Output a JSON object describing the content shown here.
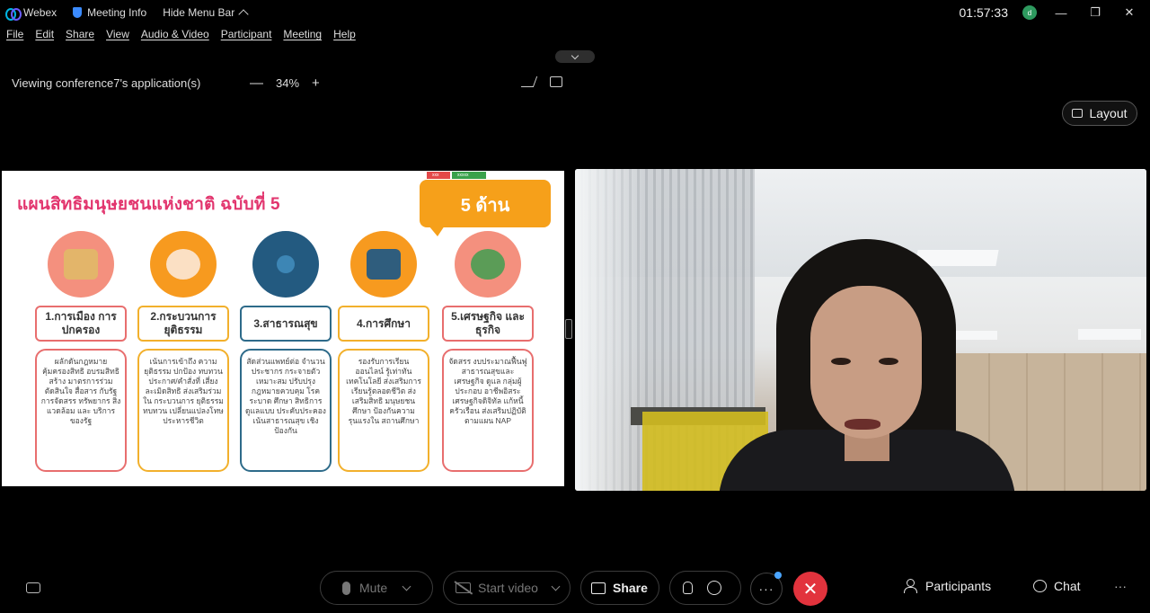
{
  "titlebar": {
    "app_name": "Webex",
    "meeting_info": "Meeting Info",
    "hide_menu": "Hide Menu Bar",
    "clock": "01:57:33",
    "avatar_initials": "d",
    "minimize": "—",
    "restore": "❐",
    "close": "✕"
  },
  "menu": {
    "items": [
      "File",
      "Edit",
      "Share",
      "View",
      "Audio & Video",
      "Participant",
      "Meeting",
      "Help"
    ]
  },
  "sharebar": {
    "viewing_text": "Viewing conference7's application(s)",
    "zoom_out": "—",
    "zoom_level": "34%",
    "zoom_in": "+"
  },
  "layout_button": "Layout",
  "slide": {
    "title": "แผนสิทธิมนุษยชนแห่งชาติ ฉบับที่ 5",
    "badge": "5 ด้าน",
    "mini_badges": [
      "xxx",
      "xxxxx"
    ],
    "columns": [
      {
        "label": "1.การเมือง การปกครอง",
        "desc": "ผลักดันกฎหมาย คุ้มครองสิทธิ อบรมสิทธิ สร้าง มาตรการร่วม ตัดสินใจ สื่อสาร กับรัฐ การจัดสรร ทรัพยากร สิ่งแวดล้อม และ บริการของรัฐ",
        "color": "#e86e6e",
        "circle": "#f4907e",
        "icon": "temple-icon"
      },
      {
        "label": "2.กระบวนการ ยุติธรรม",
        "desc": "เน้นการเข้าถึง ความยุติธรรม ปกป้อง ทบทวน ประกาศ/คำสั่งที่ เสี่ยงละเมิดสิทธิ ส่งเสริมร่วมใน กระบวนการ ยุติธรรม ทบทวน เปลี่ยนแปลงโทษ ประหารชีวิต",
        "color": "#f2b02c",
        "circle": "#f79a1f",
        "icon": "justice-hand-icon"
      },
      {
        "label": "3.สาธารณสุข",
        "desc": "สัดส่วนแพทย์ต่อ จำนวนประชากร กระจายตัว เหมาะสม ปรับปรุง กฎหมายควบคุม โรคระบาด ศึกษา สิทธิการดูแลแบบ ประคับประคอง เน้นสาธารณสุข เชิงป้องกัน",
        "color": "#2e6b8a",
        "circle": "#235a80",
        "icon": "health-network-icon"
      },
      {
        "label": "4.การศึกษา",
        "desc": "รองรับการเรียน ออนไลน์ รู้เท่าทัน เทคโนโลยี ส่งเสริมการ เรียนรู้ตลอดชีวิต ส่งเสริมสิทธิ มนุษยชนศึกษา ป้องกันความ รุนแรงใน สถานศึกษา",
        "color": "#f2b02c",
        "circle": "#f79a1f",
        "icon": "classroom-icon"
      },
      {
        "label": "5.เศรษฐกิจ และธุรกิจ",
        "desc": "จัดสรร งบประมาณฟื้นฟู สาธารณสุขและ เศรษฐกิจ ดูแล กลุ่มผู้ประกอบ อาชีพอิสระ เศรษฐกิจดิจิทัล แก้หนี้ครัวเรือน ส่งเสริมปฏิบัติ ตามแผน NAP",
        "color": "#e86e6e",
        "circle": "#f4907e",
        "icon": "globe-coins-icon"
      }
    ]
  },
  "controls": {
    "mute": "Mute",
    "start_video": "Start video",
    "share": "Share",
    "more": "···",
    "end": "✕",
    "participants": "Participants",
    "chat": "Chat",
    "overflow": "···"
  }
}
